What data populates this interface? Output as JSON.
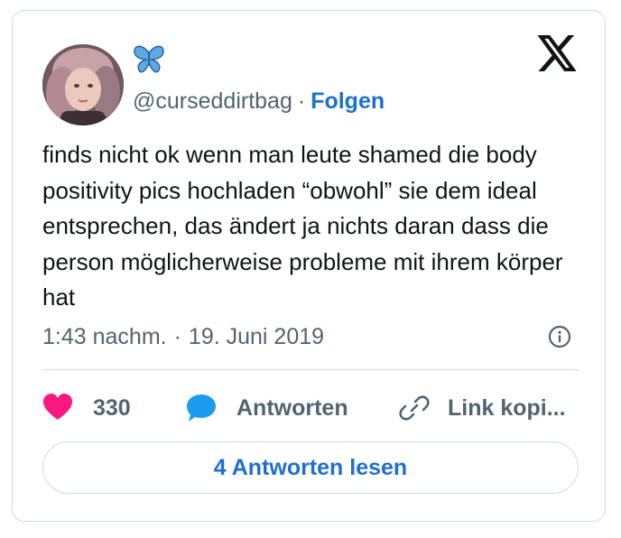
{
  "tweet": {
    "handle": "@curseddirtbag",
    "separator": "·",
    "follow_label": "Folgen",
    "text": "finds nicht ok wenn man leute shamed die body positivity pics hochladen “obwohl” sie dem ideal entsprechen, das ändert ja nichts daran dass die person möglicherweise probleme mit ihrem körper hat",
    "time": "1:43 nachm.",
    "date_separator": "·",
    "date": "19. Juni 2019"
  },
  "actions": {
    "like_count": "330",
    "reply_label": "Antworten",
    "copy_label": "Link kopi..."
  },
  "read_replies_label": "4 Antworten lesen",
  "icons": {
    "name_badge": "butterfly-icon",
    "platform": "x-logo-icon",
    "info": "info-icon",
    "like": "heart-icon",
    "reply": "speech-bubble-icon",
    "copy": "link-icon"
  },
  "colors": {
    "accent": "#1d6fd1",
    "like": "#f91880",
    "reply": "#1d9bf0",
    "secondary_text": "#536471",
    "border": "#cfd9de",
    "butterfly": "#5fa8e6"
  }
}
